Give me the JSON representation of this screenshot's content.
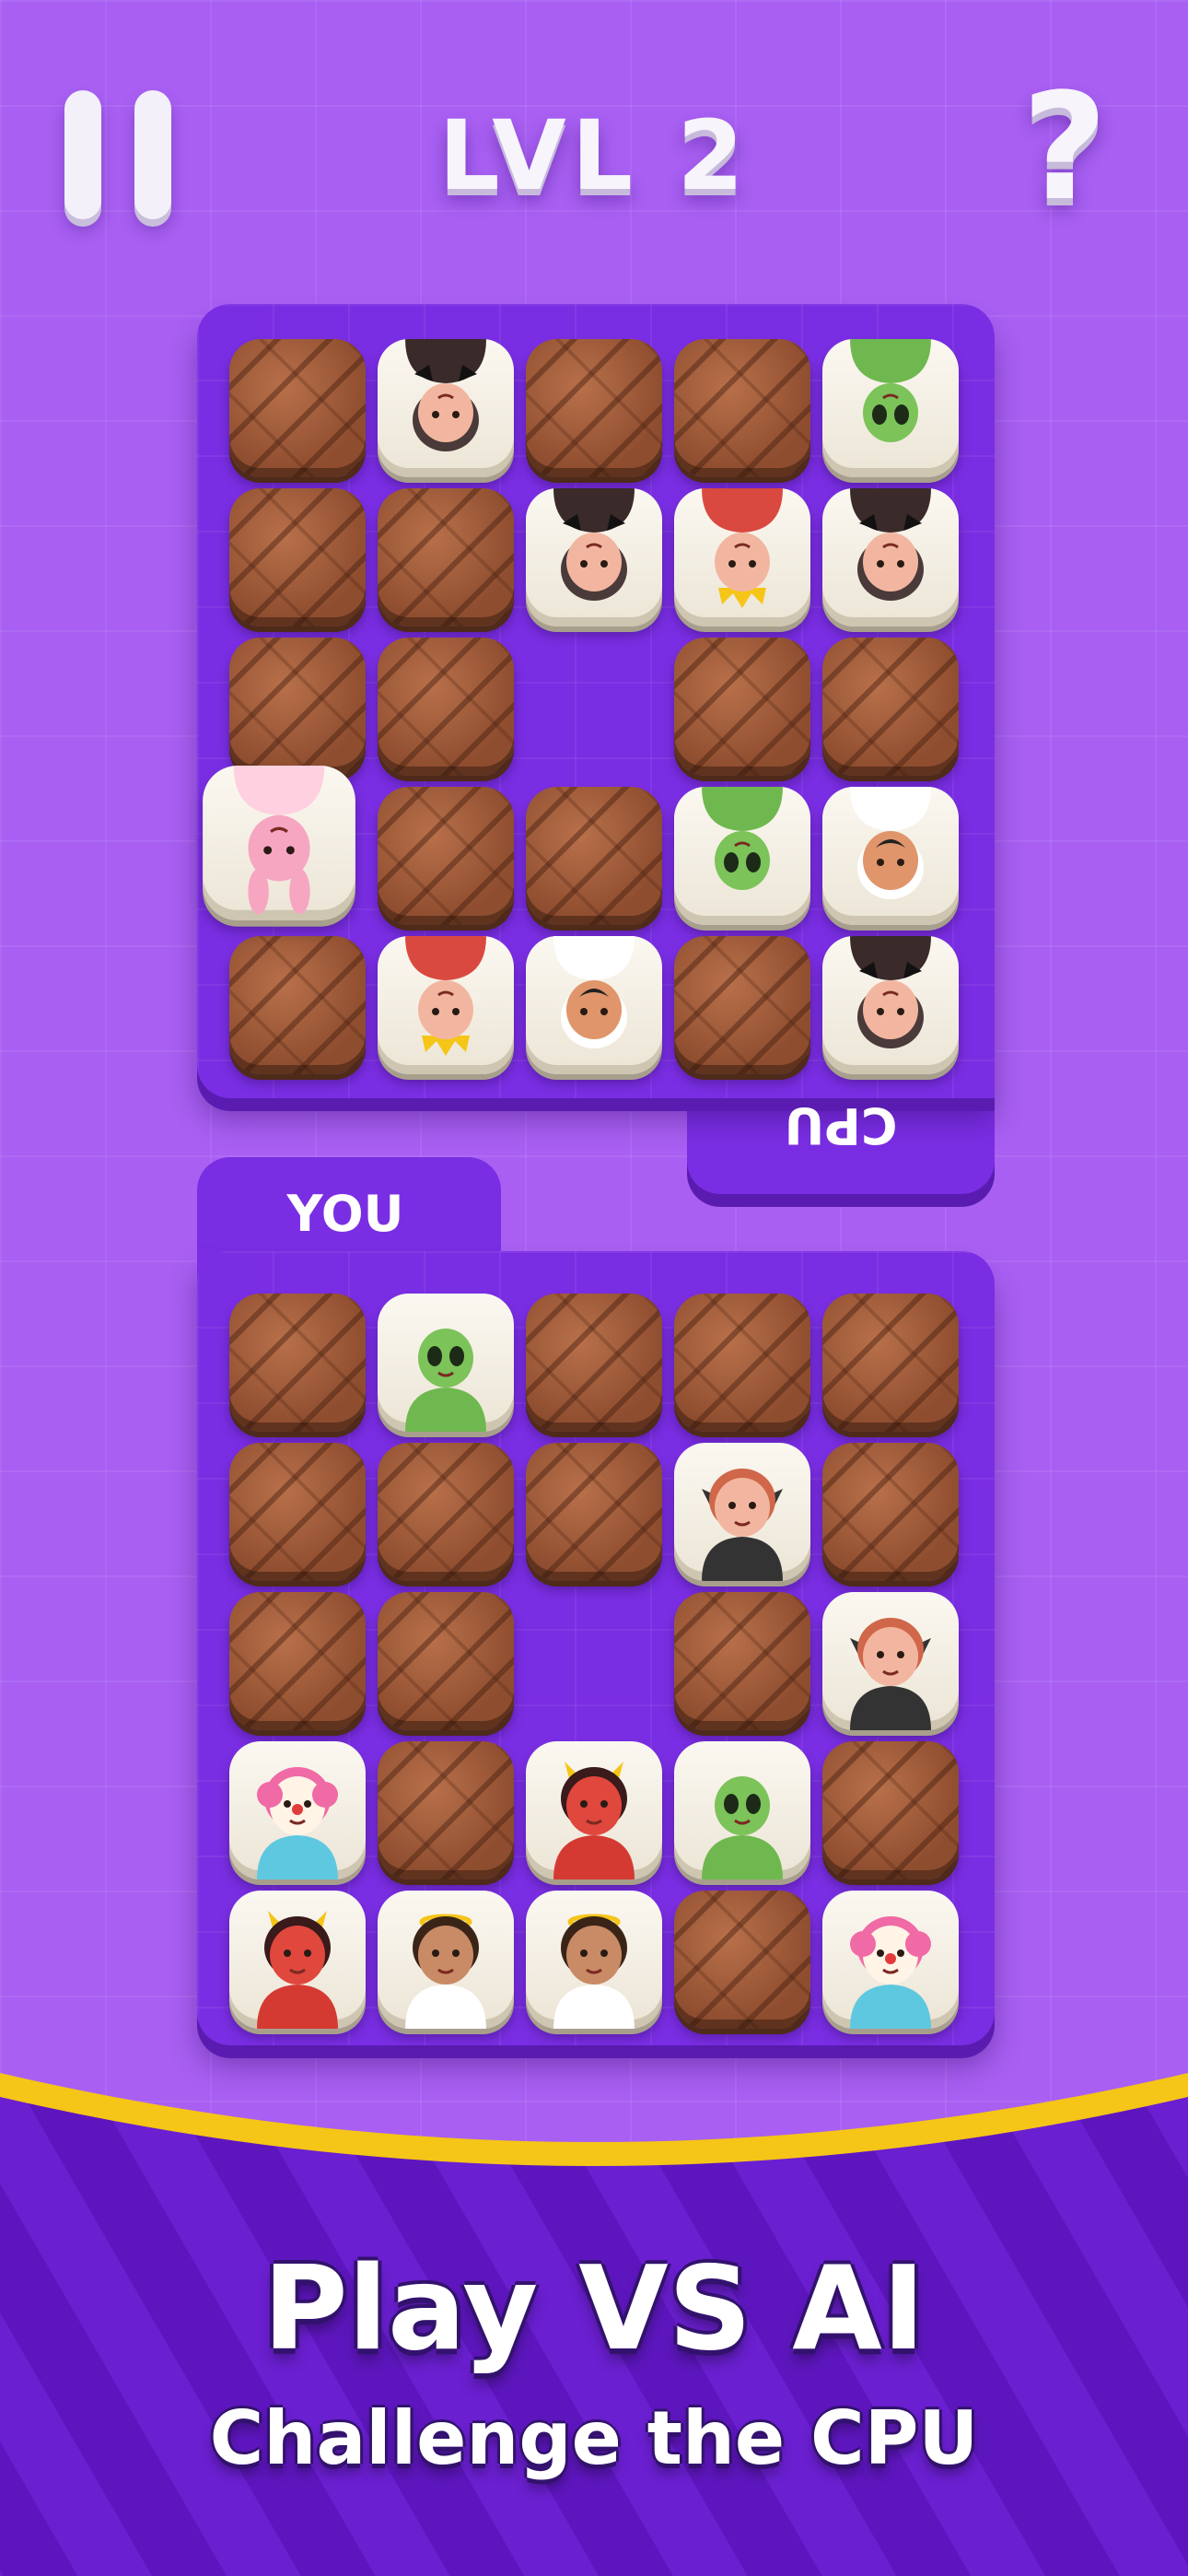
{
  "header": {
    "level_label": "LVL 2",
    "help_label": "?",
    "pause_icon": "pause-icon"
  },
  "cpu_board": {
    "label": "CPU",
    "rows": [
      [
        "back",
        "vampire",
        "back",
        "back",
        "alien"
      ],
      [
        "back",
        "back",
        "vampire",
        "king",
        "vampire"
      ],
      [
        "back",
        "back",
        "empty",
        "back",
        "back"
      ],
      [
        "bunny",
        "back",
        "back",
        "alien",
        "villain"
      ],
      [
        "back",
        "king",
        "villain",
        "back",
        "vampire"
      ]
    ]
  },
  "player_board": {
    "label": "YOU",
    "rows": [
      [
        "back",
        "alien",
        "back",
        "back",
        "back"
      ],
      [
        "back",
        "back",
        "back",
        "vampire-girl",
        "back"
      ],
      [
        "back",
        "back",
        "empty",
        "back",
        "vampire-girl"
      ],
      [
        "clown",
        "back",
        "devil",
        "alien",
        "back"
      ],
      [
        "devil",
        "angel",
        "angel",
        "back",
        "clown"
      ]
    ]
  },
  "banner": {
    "title": "Play VS AI",
    "subtitle": "Challenge the CPU",
    "accent_color": "#f5c518",
    "background_color": "#6a1fd0"
  }
}
